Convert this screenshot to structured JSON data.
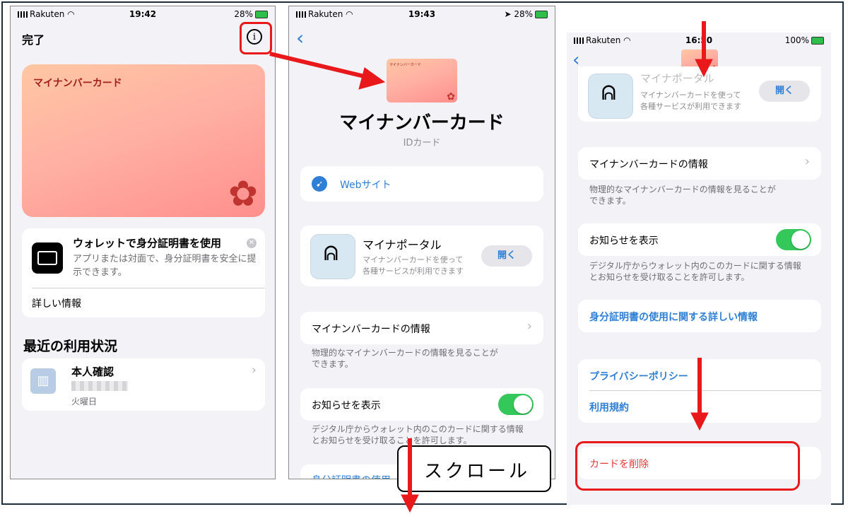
{
  "colors": {
    "accent_blue": "#2f7fd6",
    "toggle_green": "#34c759",
    "danger_red": "#e53935",
    "annotation_red": "#e8181b"
  },
  "phone1": {
    "status": {
      "carrier": "Rakuten",
      "time": "19:42",
      "battery": "28%"
    },
    "done": "完了",
    "info_icon": "info-icon",
    "card_title": "マイナンバーカード",
    "wallet_box": {
      "title": "ウォレットで身分証明書を使用",
      "desc": "アプリまたは対面で、身分証明書を安全に提示できます。",
      "more": "詳しい情報"
    },
    "recent_header": "最近の利用状況",
    "recent_item": {
      "title": "本人確認",
      "day": "火曜日"
    }
  },
  "phone2": {
    "status": {
      "carrier": "Rakuten",
      "time": "19:43",
      "battery": "28%"
    },
    "mini_card_text": "マイナンバーカード",
    "title": "マイナンバーカード",
    "subtitle": "IDカード",
    "website": "Webサイト",
    "app": {
      "name": "マイナポータル",
      "desc1": "マイナンバーカードを使って",
      "desc2": "各種サービスが利用できます",
      "open": "開く"
    },
    "info_row": "マイナンバーカードの情報",
    "info_desc": "物理的なマイナンバーカードの情報を見ることができます。",
    "notify_row": "お知らせを表示",
    "notify_desc": "デジタル庁からウォレット内のこのカードに関する情報とお知らせを受け取ることを許可します。",
    "cut_text": "身分証明書の使用",
    "scroll_label": "スクロール"
  },
  "phone3": {
    "status": {
      "carrier": "Rakuten",
      "time": "16:50",
      "battery": "100%"
    },
    "app": {
      "name": "マイナポータル",
      "desc1": "マイナンバーカードを使って",
      "desc2": "各種サービスが利用できます",
      "open": "開く"
    },
    "info_row": "マイナンバーカードの情報",
    "info_desc": "物理的なマイナンバーカードの情報を見ることができます。",
    "notify_row": "お知らせを表示",
    "notify_desc": "デジタル庁からウォレット内のこのカードに関する情報とお知らせを受け取ることを許可します。",
    "id_more": "身分証明書の使用に関する詳しい情報",
    "privacy": "プライバシーポリシー",
    "terms": "利用規約",
    "delete": "カードを削除"
  }
}
